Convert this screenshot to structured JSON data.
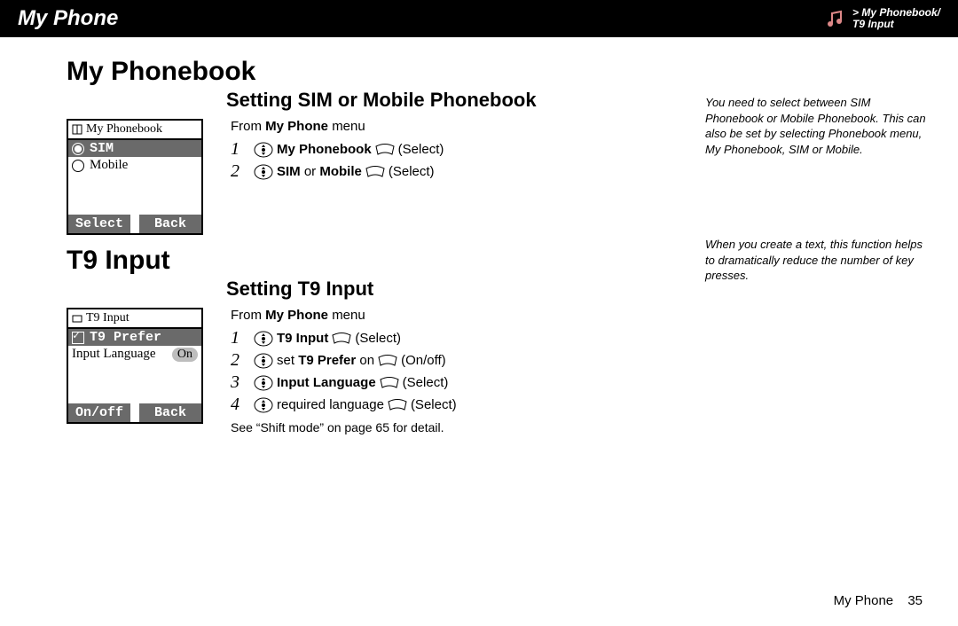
{
  "header": {
    "title": "My Phone",
    "breadcrumb_line1": "> My Phonebook/",
    "breadcrumb_line2": "T9 Input"
  },
  "sections": {
    "phonebook": {
      "heading": "My Phonebook",
      "sub": "Setting SIM or Mobile Phonebook",
      "from": "From",
      "from_bold": "My Phone",
      "from_tail": "menu",
      "steps": [
        {
          "n": "1",
          "bold": "My Phonebook",
          "tail": "",
          "paren": "(Select)"
        },
        {
          "n": "2",
          "bold": "SIM",
          "mid": " or ",
          "bold2": "Mobile",
          "paren": "(Select)"
        }
      ],
      "screen": {
        "title": "My Phonebook",
        "items": [
          {
            "label": "SIM",
            "selected": true
          },
          {
            "label": "Mobile",
            "selected": false
          }
        ],
        "soft_left": "Select",
        "soft_right": "Back"
      }
    },
    "t9": {
      "heading": "T9 Input",
      "sub": "Setting T9 Input",
      "from": "From",
      "from_bold": "My Phone",
      "from_tail": "menu",
      "steps": [
        {
          "n": "1",
          "bold": "T9 Input",
          "paren": "(Select)"
        },
        {
          "n": "2",
          "pre": "set ",
          "bold": "T9 Prefer",
          "tail": " on ",
          "paren": "(On/off)"
        },
        {
          "n": "3",
          "bold": "Input Language",
          "paren": "(Select)"
        },
        {
          "n": "4",
          "pre": "required language ",
          "paren": "(Select)"
        }
      ],
      "note": "See “Shift mode” on page 65 for detail.",
      "screen": {
        "title": "T9 Input",
        "items": [
          {
            "label": "T9 Prefer",
            "selected": true,
            "checked": true
          },
          {
            "label": "Input Language",
            "toggle": "On"
          }
        ],
        "soft_left": "On/off",
        "soft_right": "Back"
      }
    }
  },
  "sidebar": {
    "phonebook_note": "You need to select between SIM Phonebook or Mobile Phonebook. This can also be set by selecting Phonebook menu, My Phonebook, SIM or Mobile.",
    "t9_note": "When you create a text, this function helps to dramatically reduce the number of key presses."
  },
  "footer": {
    "label": "My Phone",
    "page": "35"
  }
}
